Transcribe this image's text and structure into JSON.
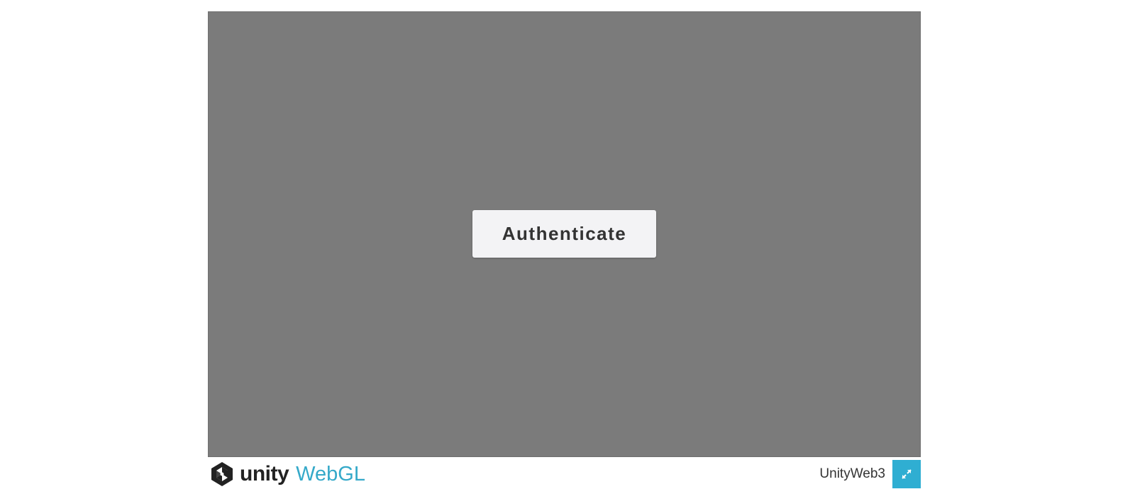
{
  "canvas": {
    "background_color": "#7b7b7b",
    "authenticate_button": {
      "label": "Authenticate"
    }
  },
  "footer": {
    "logo": {
      "icon": "unity-logo-icon",
      "word_unity": "unity",
      "word_webgl": "WebGL",
      "webgl_color": "#35a9c9"
    },
    "build_title": "UnityWeb3",
    "fullscreen_button": {
      "icon": "fullscreen-icon",
      "color": "#2faed2"
    }
  }
}
